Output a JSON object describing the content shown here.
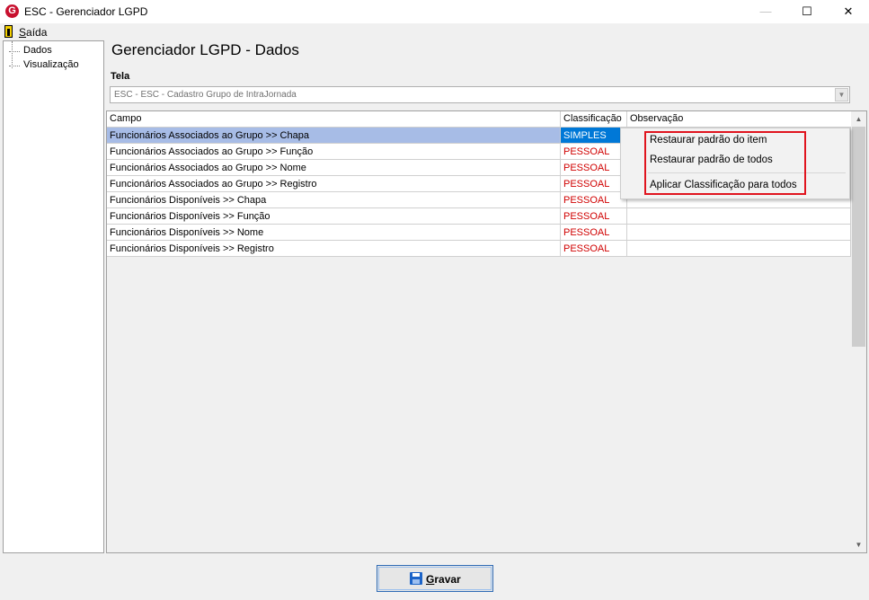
{
  "window": {
    "title": "ESC - Gerenciador LGPD",
    "icon_letter": "G",
    "controls": {
      "minimize": "—",
      "maximize": "☐",
      "close": "✕"
    }
  },
  "menu": {
    "exit_label_first": "S",
    "exit_label_rest": "aída"
  },
  "tree": {
    "items": [
      {
        "label": "Dados"
      },
      {
        "label": "Visualização"
      }
    ]
  },
  "page": {
    "title": "Gerenciador LGPD - Dados",
    "tela_label": "Tela",
    "tela_value": "ESC - ESC - Cadastro Grupo de IntraJornada"
  },
  "grid": {
    "columns": [
      "Campo",
      "Classificação",
      "Observação"
    ],
    "rows": [
      {
        "campo": "Funcionários Associados ao Grupo >> Chapa",
        "classificacao": "SIMPLES",
        "observacao": ""
      },
      {
        "campo": "Funcionários Associados ao Grupo >> Função",
        "classificacao": "PESSOAL",
        "observacao": ""
      },
      {
        "campo": "Funcionários Associados ao Grupo >> Nome",
        "classificacao": "PESSOAL",
        "observacao": ""
      },
      {
        "campo": "Funcionários Associados ao Grupo >> Registro",
        "classificacao": "PESSOAL",
        "observacao": ""
      },
      {
        "campo": "Funcionários Disponíveis >> Chapa",
        "classificacao": "PESSOAL",
        "observacao": ""
      },
      {
        "campo": "Funcionários Disponíveis >> Função",
        "classificacao": "PESSOAL",
        "observacao": ""
      },
      {
        "campo": "Funcionários Disponíveis >> Nome",
        "classificacao": "PESSOAL",
        "observacao": ""
      },
      {
        "campo": "Funcionários Disponíveis >> Registro",
        "classificacao": "PESSOAL",
        "observacao": ""
      }
    ]
  },
  "context_menu": {
    "items": [
      "Restaurar padrão do item",
      "Restaurar padrão de todos",
      "Aplicar Classificação para todos"
    ]
  },
  "buttons": {
    "save_first": "G",
    "save_rest": "ravar"
  },
  "colors": {
    "selected_row": "#a7bce6",
    "selected_cell": "#0078d7",
    "classification_text": "#d00000",
    "highlight_box": "#e0141e"
  }
}
